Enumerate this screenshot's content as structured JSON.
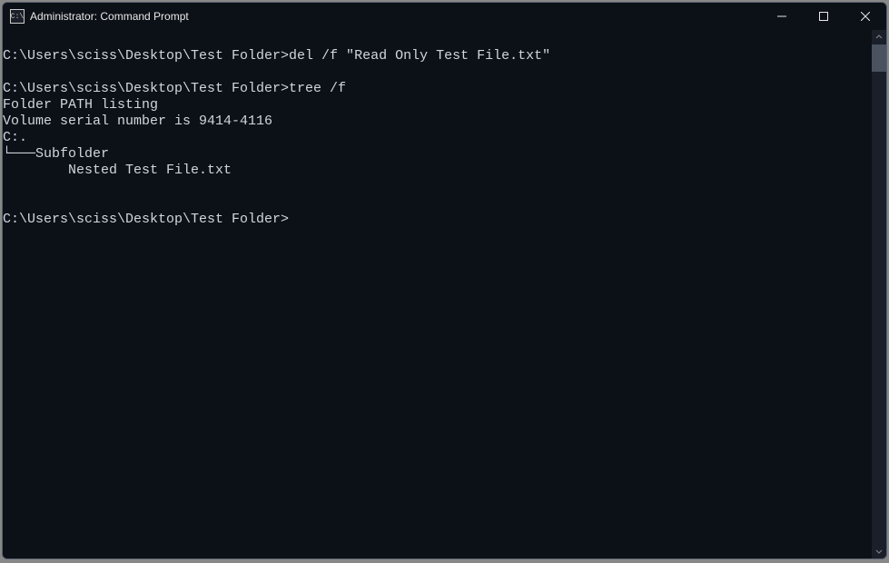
{
  "window": {
    "title": "Administrator: Command Prompt"
  },
  "terminal": {
    "lines": [
      "",
      "C:\\Users\\sciss\\Desktop\\Test Folder>del /f \"Read Only Test File.txt\"",
      "",
      "C:\\Users\\sciss\\Desktop\\Test Folder>tree /f",
      "Folder PATH listing",
      "Volume serial number is 9414-4116",
      "C:.",
      "└───Subfolder",
      "        Nested Test File.txt",
      "",
      "",
      "C:\\Users\\sciss\\Desktop\\Test Folder>"
    ]
  },
  "titlebar_icon_text": "C:\\"
}
